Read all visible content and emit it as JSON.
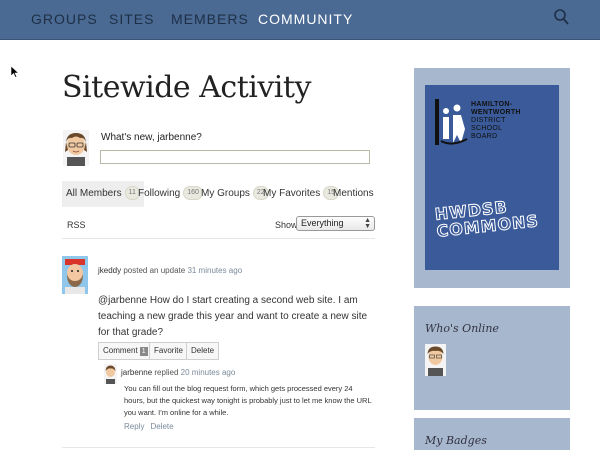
{
  "nav": {
    "items": [
      {
        "label": "GROUPS",
        "active": false
      },
      {
        "label": "SITES",
        "active": false
      },
      {
        "label": "MEMBERS",
        "active": false
      },
      {
        "label": "COMMUNITY",
        "active": true
      }
    ],
    "bg_color": "#4a6a94"
  },
  "page": {
    "title": "Sitewide Activity"
  },
  "whats_new": {
    "label": "What's new, jarbenne?",
    "value": ""
  },
  "tabs": [
    {
      "label": "All Members",
      "count": "11",
      "active": true
    },
    {
      "label": "Following",
      "count": "160",
      "active": false
    },
    {
      "label": "My Groups",
      "count": "22",
      "active": false
    },
    {
      "label": "My Favorites",
      "count": "15",
      "active": false
    },
    {
      "label": "Mentions",
      "count": "",
      "active": false
    }
  ],
  "filter": {
    "rss_label": "RSS",
    "show_label": "Show:",
    "selected": "Everything"
  },
  "activity": {
    "user": "jkeddy",
    "action": "posted an update",
    "time": "31 minutes ago",
    "body": "@jarbenne How do I start creating a second web site. I am teaching a new grade this year and want to create a new site for that grade?",
    "buttons": {
      "comment": "Comment",
      "comment_count": "1",
      "favorite": "Favorite",
      "delete": "Delete"
    },
    "reply": {
      "user": "jarbenne",
      "action": "replied",
      "time": "20 minutes ago",
      "body": "You can fill out the blog request form, which gets processed every 24 hours, but the quickest way tonight is probably just to let me know the URL you want. I'm online for a while.",
      "reply_label": "Reply",
      "delete_label": "Delete"
    }
  },
  "sidebar": {
    "logo_text_lines": [
      "HAMILTON-",
      "WENTWORTH",
      "DISTRICT",
      "SCHOOL",
      "BOARD"
    ],
    "commons_text": "HWDSB COMMONS",
    "whos_online_title": "Who's Online",
    "my_badges_title": "My Badges",
    "widget_color": "#a7b7cd",
    "logo_bg_color": "#3a5a99"
  }
}
